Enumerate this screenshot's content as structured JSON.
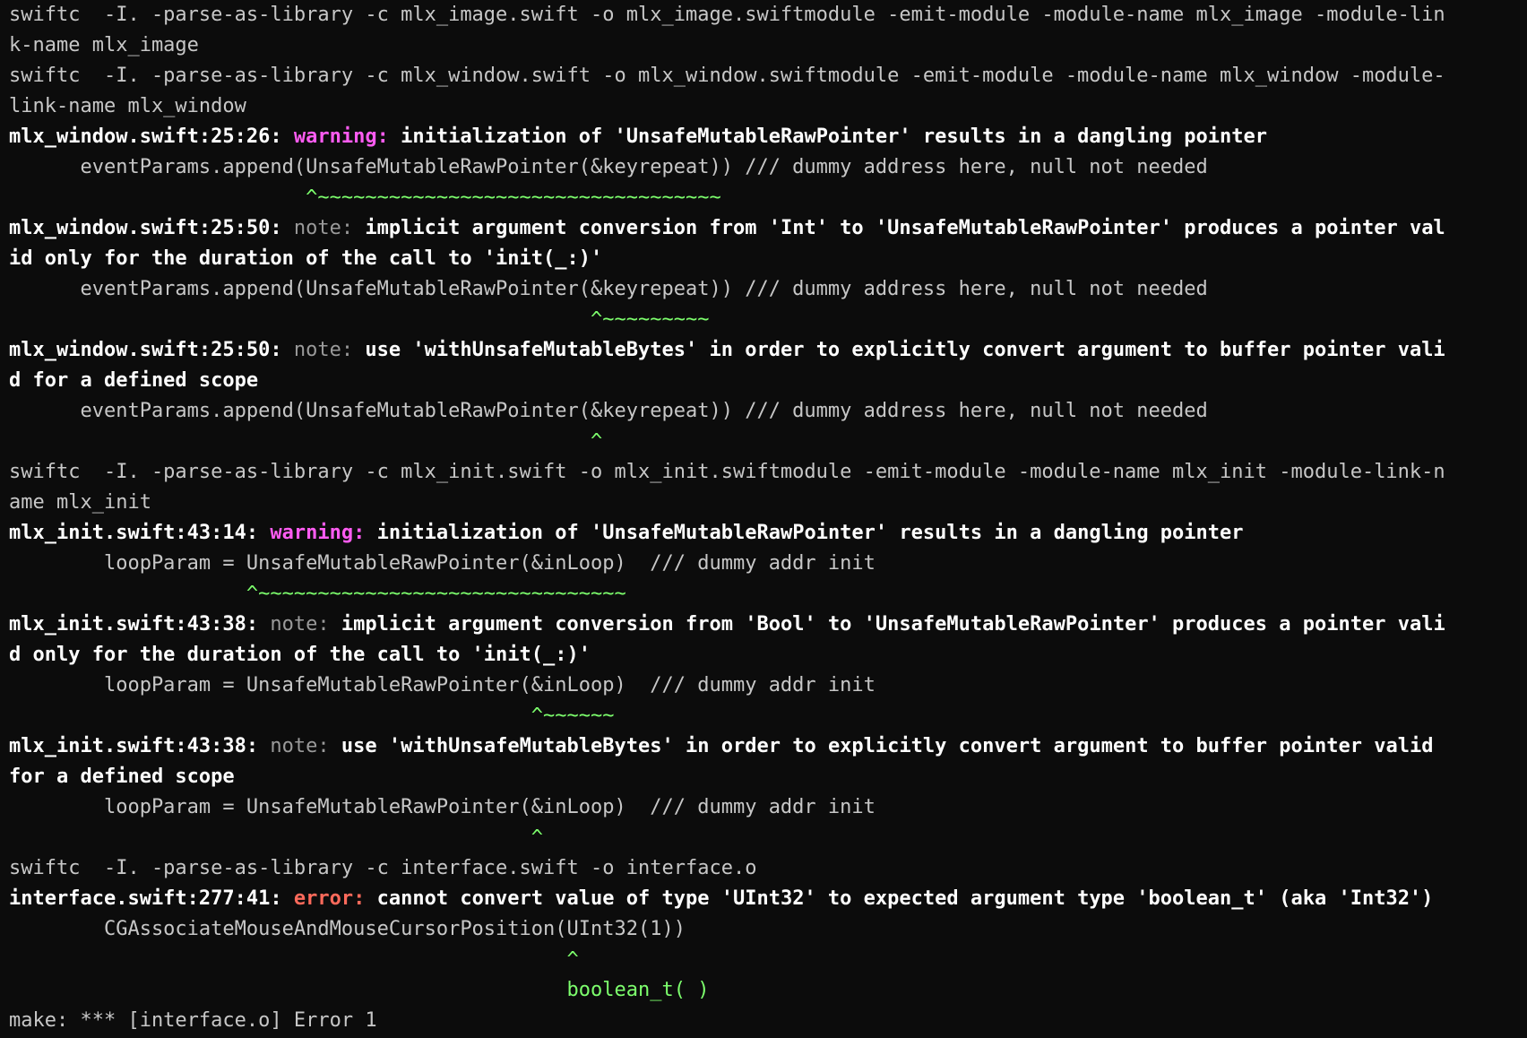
{
  "colors": {
    "background": "#0c0c0c",
    "text": "#c7c7c7",
    "bold_text": "#ffffff",
    "warning": "#ff5cf2",
    "note": "#9a9a9a",
    "error": "#ff6a5b",
    "caret": "#7dff6d"
  },
  "lines": [
    "swiftc  -I. -parse-as-library -c mlx_image.swift -o mlx_image.swiftmodule -emit-module -module-name mlx_image -module-lin",
    "k-name mlx_image",
    "swiftc  -I. -parse-as-library -c mlx_window.swift -o mlx_window.swiftmodule -emit-module -module-name mlx_window -module-",
    "link-name mlx_window",
    {
      "loc": "mlx_window.swift:25:26: ",
      "kind": "warning: ",
      "msg": "initialization of 'UnsafeMutableRawPointer' results in a dangling pointer"
    },
    "      eventParams.append(UnsafeMutableRawPointer(&keyrepeat)) /// dummy address here, null not needed",
    "                         ^~~~~~~~~~~~~~~~~~~~~~~~~~~~~~~~~~~",
    {
      "loc": "mlx_window.swift:25:50: ",
      "kind": "note: ",
      "msg": "implicit argument conversion from 'Int' to 'UnsafeMutableRawPointer' produces a pointer val"
    },
    "id only for the duration of the call to 'init(_:)'",
    "      eventParams.append(UnsafeMutableRawPointer(&keyrepeat)) /// dummy address here, null not needed",
    "                                                 ^~~~~~~~~~",
    {
      "loc": "mlx_window.swift:25:50: ",
      "kind": "note: ",
      "msg": "use 'withUnsafeMutableBytes' in order to explicitly convert argument to buffer pointer vali"
    },
    "d for a defined scope",
    "      eventParams.append(UnsafeMutableRawPointer(&keyrepeat)) /// dummy address here, null not needed",
    "                                                 ^",
    "swiftc  -I. -parse-as-library -c mlx_init.swift -o mlx_init.swiftmodule -emit-module -module-name mlx_init -module-link-n",
    "ame mlx_init",
    {
      "loc": "mlx_init.swift:43:14: ",
      "kind": "warning: ",
      "msg": "initialization of 'UnsafeMutableRawPointer' results in a dangling pointer"
    },
    "        loopParam = UnsafeMutableRawPointer(&inLoop)  /// dummy addr init",
    "                    ^~~~~~~~~~~~~~~~~~~~~~~~~~~~~~~~",
    {
      "loc": "mlx_init.swift:43:38: ",
      "kind": "note: ",
      "msg": "implicit argument conversion from 'Bool' to 'UnsafeMutableRawPointer' produces a pointer vali"
    },
    "d only for the duration of the call to 'init(_:)'",
    "        loopParam = UnsafeMutableRawPointer(&inLoop)  /// dummy addr init",
    "                                            ^~~~~~~",
    {
      "loc": "mlx_init.swift:43:38: ",
      "kind": "note: ",
      "msg": "use 'withUnsafeMutableBytes' in order to explicitly convert argument to buffer pointer valid"
    },
    "for a defined scope",
    "        loopParam = UnsafeMutableRawPointer(&inLoop)  /// dummy addr init",
    "                                            ^",
    "swiftc  -I. -parse-as-library -c interface.swift -o interface.o",
    {
      "loc": "interface.swift:277:41: ",
      "kind": "error: ",
      "msg": "cannot convert value of type 'UInt32' to expected argument type 'boolean_t' (aka 'Int32')"
    },
    "        CGAssociateMouseAndMouseCursorPosition(UInt32(1))",
    "                                               ^",
    "                                               boolean_t( )",
    "make: *** [interface.o] Error 1"
  ],
  "line_styles": [
    "plain",
    "plain",
    "plain",
    "plain",
    "diag",
    "code",
    "caret",
    "diag",
    "boldcont",
    "code",
    "caret",
    "diag",
    "boldcont",
    "code",
    "caret",
    "plain",
    "plain",
    "diag",
    "code",
    "caret",
    "diag",
    "boldcont",
    "code",
    "caret",
    "diag",
    "boldcont",
    "code",
    "caret",
    "plain",
    "diag",
    "code",
    "caret",
    "caret",
    "plain"
  ]
}
